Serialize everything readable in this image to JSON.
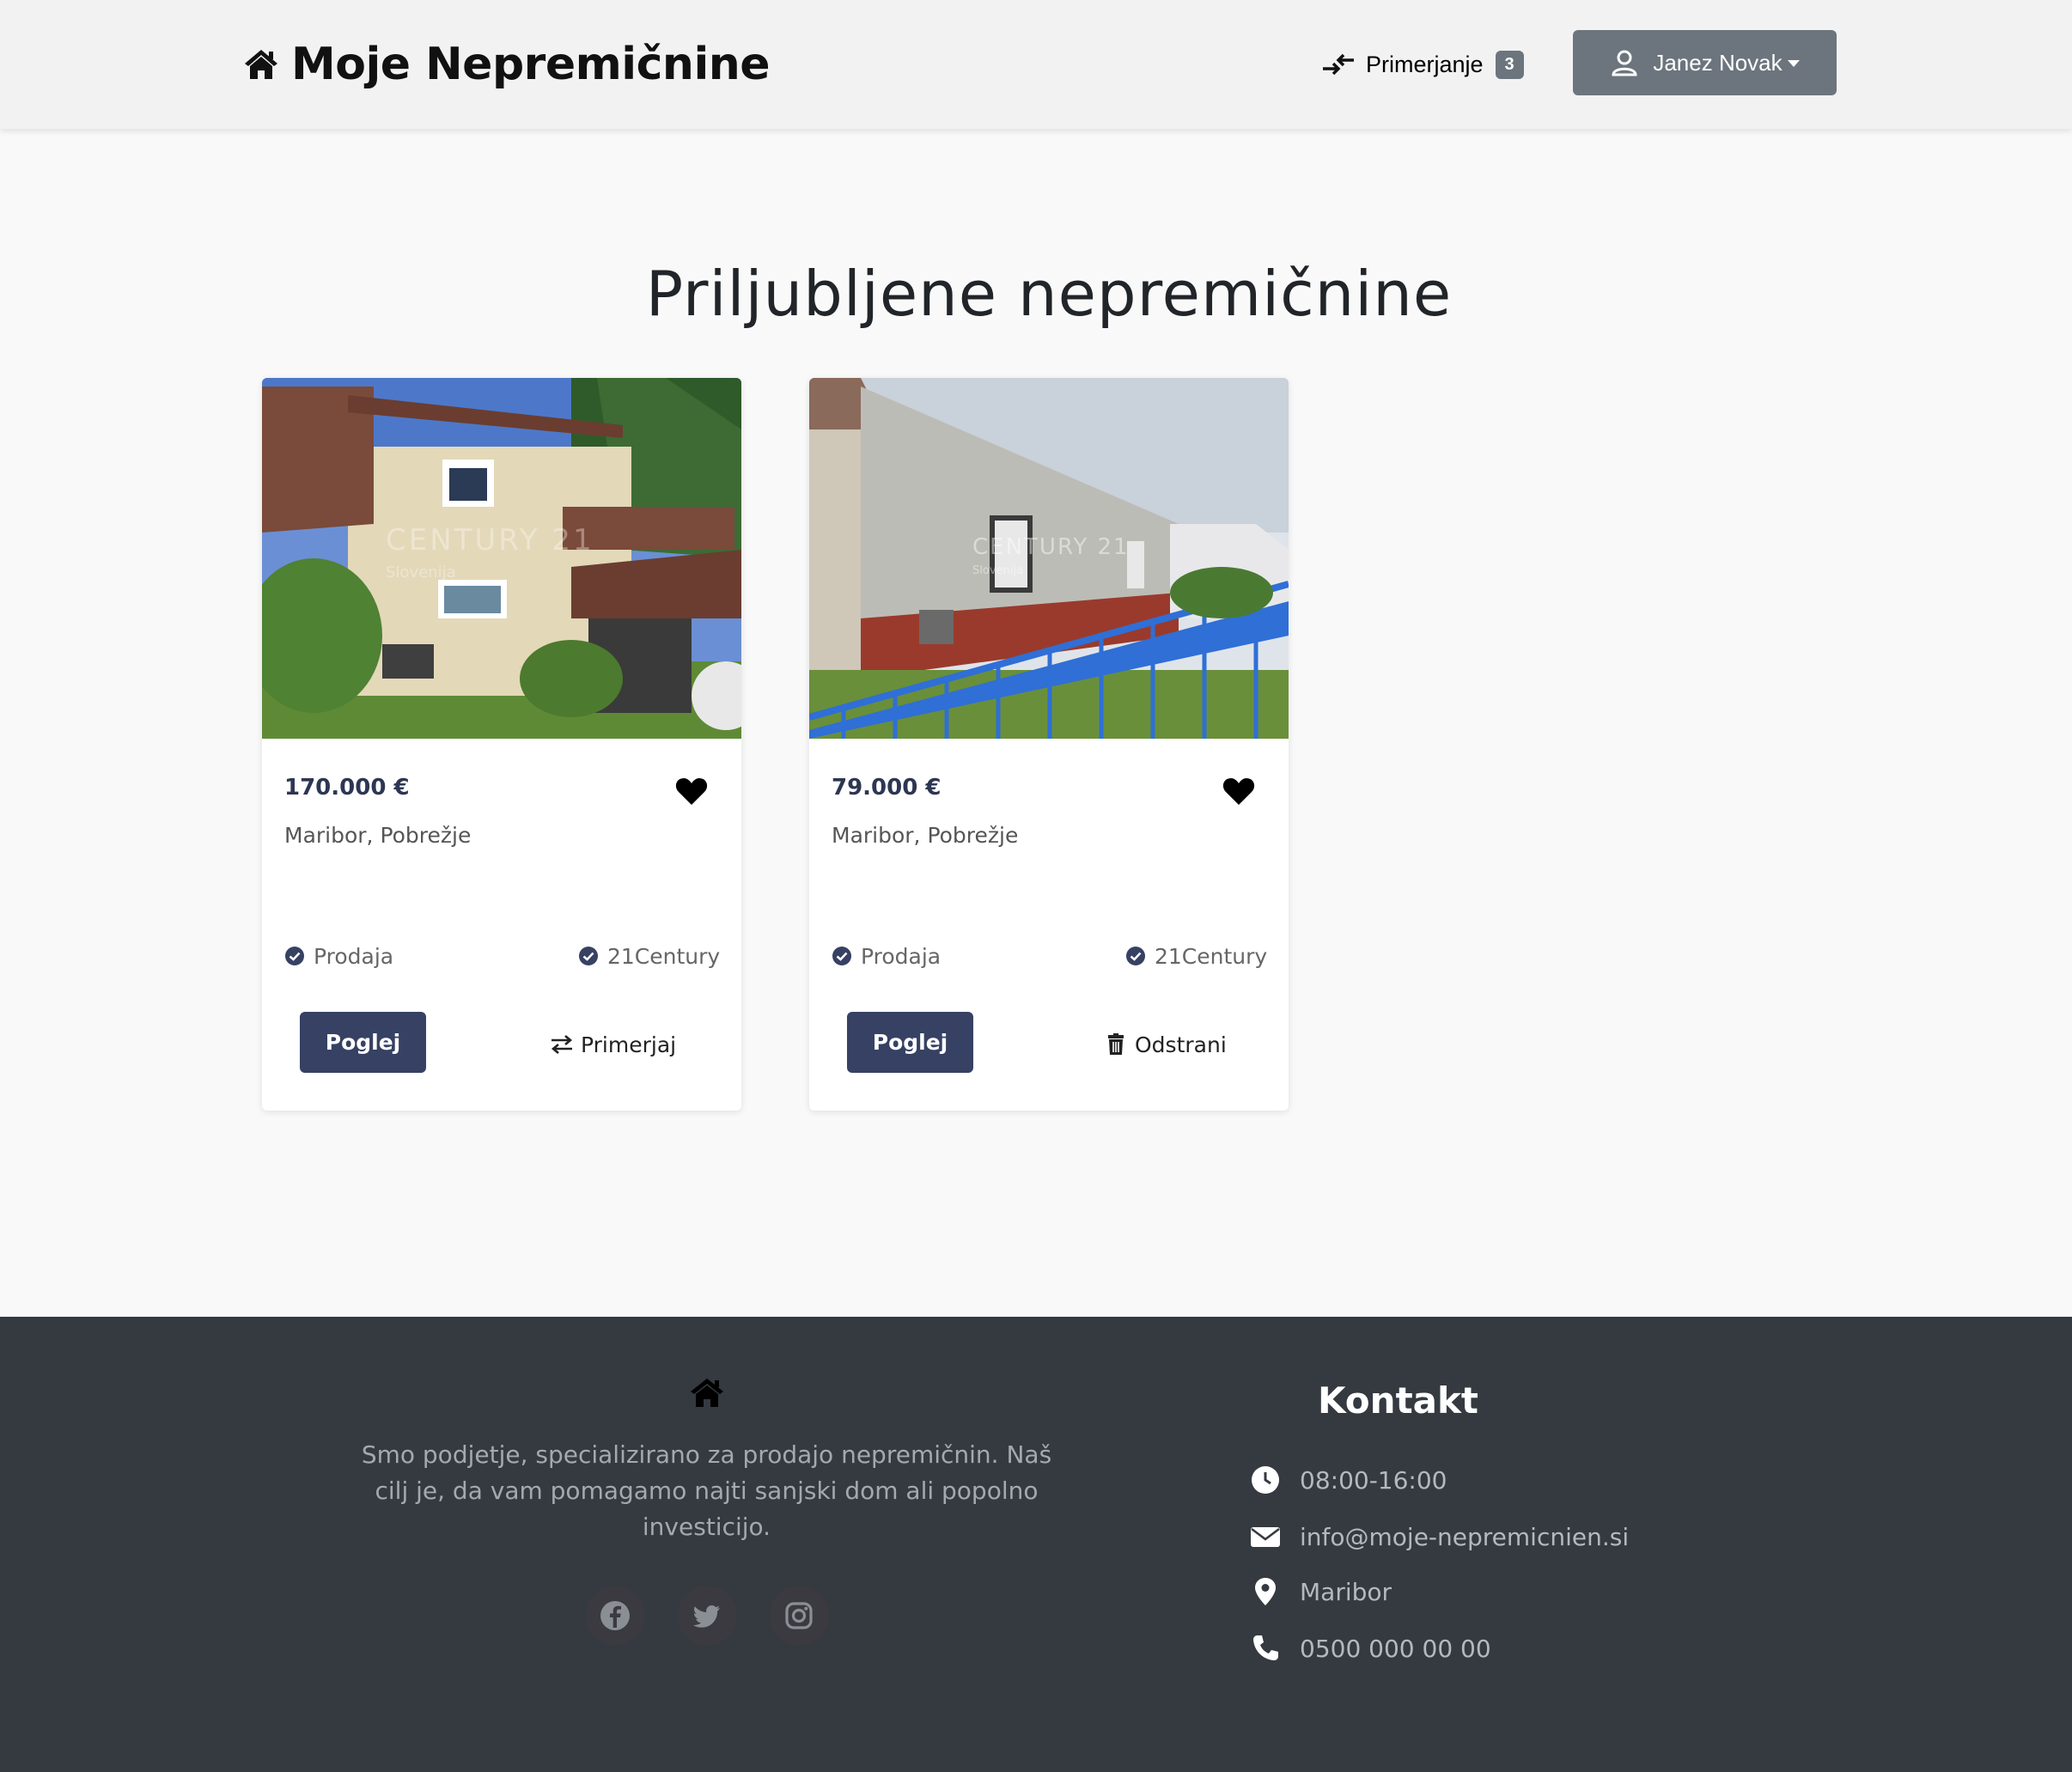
{
  "navbar": {
    "brand": "Moje Nepremičnine",
    "brand_icon": "home-icon",
    "compare_label": "Primerjanje",
    "compare_count": "3",
    "user_name": "Janez Novak"
  },
  "page": {
    "title": "Priljubljene nepremičnine"
  },
  "cards": [
    {
      "price": "170.000 €",
      "location": "Maribor, Pobrežje",
      "type": "Prodaja",
      "agency": "21Century",
      "view_label": "Poglej",
      "action_label": "Primerjaj",
      "action_icon": "compare-arrows-icon",
      "favorited": true
    },
    {
      "price": "79.000 €",
      "location": "Maribor, Pobrežje",
      "type": "Prodaja",
      "agency": "21Century",
      "view_label": "Poglej",
      "action_label": "Odstrani",
      "action_icon": "trash-icon",
      "favorited": true
    }
  ],
  "footer": {
    "about": "Smo podjetje, specializirano za prodajo nepremičnin. Naš cilj je, da vam pomagamo najti sanjski dom ali popolno investicijo.",
    "social": [
      "facebook-icon",
      "twitter-icon",
      "instagram-icon"
    ],
    "contact_title": "Kontakt",
    "hours": "08:00-16:00",
    "email": "info@moje-nepremicnien.si",
    "city": "Maribor",
    "phone": "0500 000 00 00"
  },
  "colors": {
    "navbar_bg": "#f2f2f2",
    "user_button": "#6c757d",
    "primary_button": "#364163",
    "price_text": "#2d3652",
    "footer_bg": "#343a40"
  }
}
